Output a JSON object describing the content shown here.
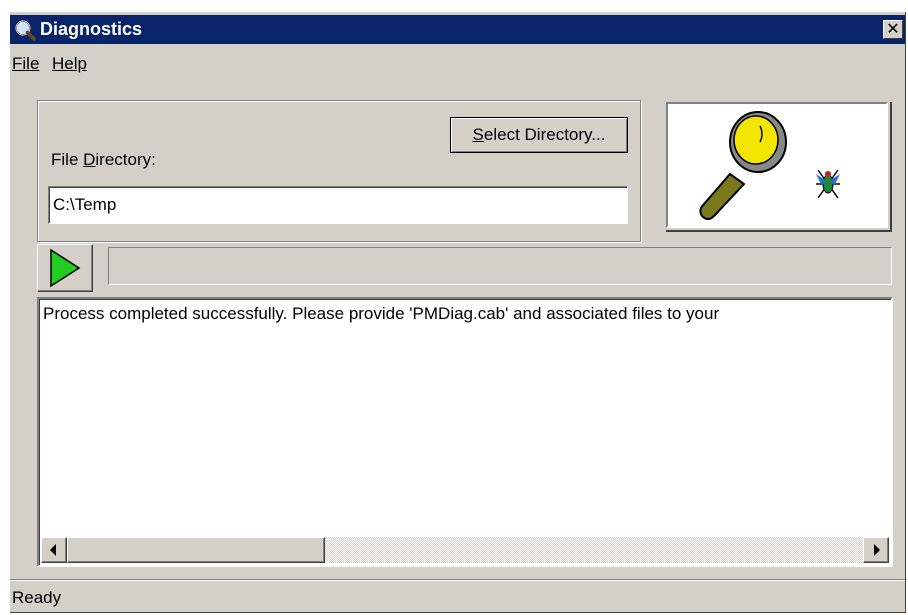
{
  "window": {
    "title": "Diagnostics",
    "close_label": "✕"
  },
  "menu": {
    "file_label": "File",
    "help_label": "Help"
  },
  "directory": {
    "label_before": "File ",
    "label_accel": "D",
    "label_after": "irectory:",
    "value": "C:\\Temp",
    "select_accel": "S",
    "select_rest": "elect Directory..."
  },
  "progress": {
    "fraction": 0
  },
  "log": {
    "text": "Process completed successfully. Please provide 'PMDiag.cab' and associated files to your"
  },
  "status": {
    "text": "Ready"
  },
  "icons": {
    "title": "magnifier-icon",
    "logo": "magnifier-bug-icon",
    "play": "play-icon",
    "scroll_left": "arrow-left-icon",
    "scroll_right": "arrow-right-icon"
  },
  "colors": {
    "titlebar": "#0a246a",
    "face": "#d4d0c8",
    "play_green": "#22cc22",
    "magnifier_yellow": "#f2e600"
  }
}
